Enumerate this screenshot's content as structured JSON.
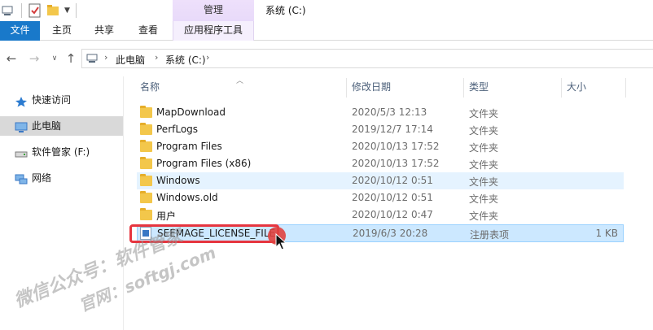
{
  "title_bar": {
    "context_tab_title": "管理",
    "window_title": "系统 (C:)"
  },
  "ribbon": {
    "tabs": [
      {
        "label": "文件"
      },
      {
        "label": "主页"
      },
      {
        "label": "共享"
      },
      {
        "label": "查看"
      },
      {
        "label": "应用程序工具"
      }
    ]
  },
  "address": {
    "crumbs": [
      "此电脑",
      "系统 (C:)"
    ]
  },
  "nav_pane": {
    "items": [
      {
        "label": "快速访问",
        "icon": "star-icon"
      },
      {
        "label": "此电脑",
        "icon": "computer-icon",
        "selected": true
      },
      {
        "label": "软件管家 (F:)",
        "icon": "drive-icon"
      },
      {
        "label": "网络",
        "icon": "network-icon"
      }
    ]
  },
  "columns": {
    "name": "名称",
    "date": "修改日期",
    "type": "类型",
    "size": "大小"
  },
  "files": [
    {
      "name": "MapDownload",
      "date": "2020/5/3 12:13",
      "type": "文件夹",
      "size": "",
      "kind": "folder"
    },
    {
      "name": "PerfLogs",
      "date": "2019/12/7 17:14",
      "type": "文件夹",
      "size": "",
      "kind": "folder"
    },
    {
      "name": "Program Files",
      "date": "2020/10/13 17:52",
      "type": "文件夹",
      "size": "",
      "kind": "folder"
    },
    {
      "name": "Program Files (x86)",
      "date": "2020/10/13 17:52",
      "type": "文件夹",
      "size": "",
      "kind": "folder"
    },
    {
      "name": "Windows",
      "date": "2020/10/12 0:51",
      "type": "文件夹",
      "size": "",
      "kind": "folder"
    },
    {
      "name": "Windows.old",
      "date": "2020/10/12 0:51",
      "type": "文件夹",
      "size": "",
      "kind": "folder"
    },
    {
      "name": "用户",
      "date": "2020/10/12 0:47",
      "type": "文件夹",
      "size": "",
      "kind": "folder"
    },
    {
      "name": "SEEMAGE_LICENSE_FILE",
      "date": "2019/6/3 20:28",
      "type": "注册表项",
      "size": "1 KB",
      "kind": "registry"
    }
  ],
  "watermark": {
    "line1": "微信公众号：软件管家",
    "line2": "官网：softgj.com"
  },
  "colors": {
    "file_tab": "#1979ca",
    "selection": "#cce8ff",
    "hover": "#e5f3ff",
    "highlight": "#e6353f"
  }
}
